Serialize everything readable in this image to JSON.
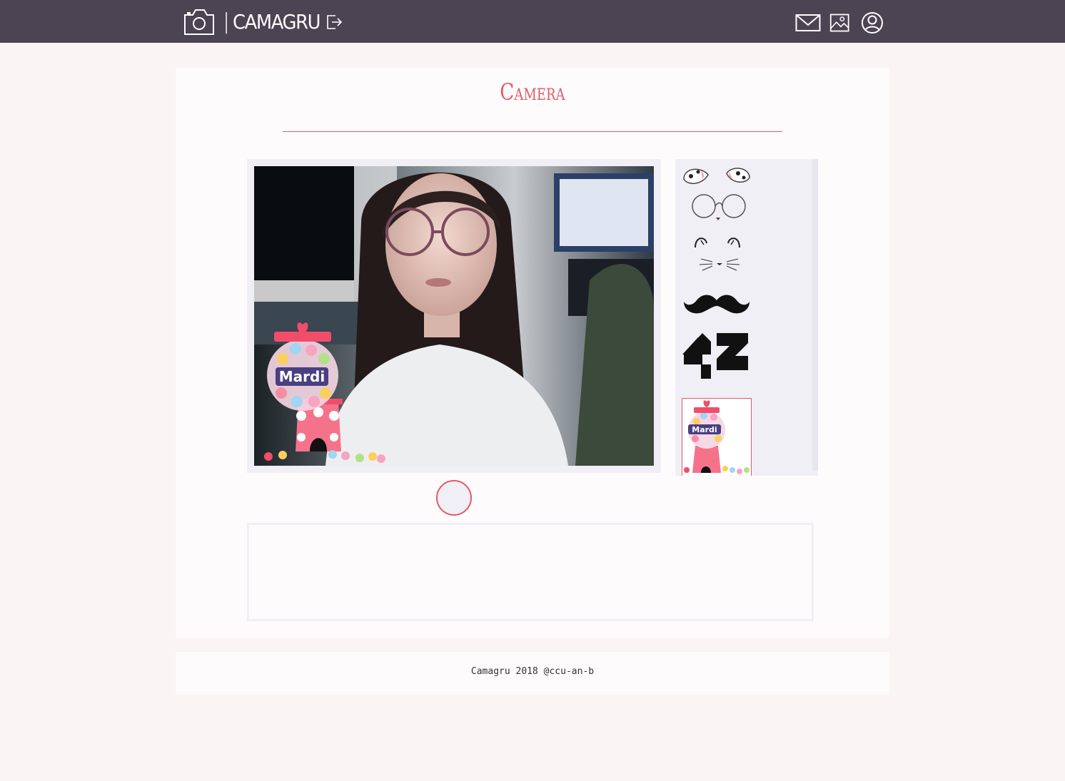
{
  "header": {
    "brand_name": "CAMAGRU",
    "brand_separator": "|",
    "icons": [
      "camera-icon",
      "logout-icon",
      "mail-icon",
      "gallery-icon",
      "profile-icon"
    ]
  },
  "main": {
    "title": "Camera",
    "sticker_text": "Mardi",
    "filters": [
      {
        "name": "dalmatian-ears"
      },
      {
        "name": "round-glasses"
      },
      {
        "name": "cat-face"
      },
      {
        "name": "mustache"
      },
      {
        "name": "42-logo",
        "label": "42"
      },
      {
        "name": "gumball-machine",
        "label": "Mardi",
        "selected": true
      }
    ]
  },
  "footer": {
    "text": "Camagru 2018 @ccu-an-b"
  },
  "colors": {
    "header_bg": "#4a4453",
    "accent": "#e15a6a",
    "page_bg": "#faf4f4",
    "panel_bg": "#efeff5"
  }
}
